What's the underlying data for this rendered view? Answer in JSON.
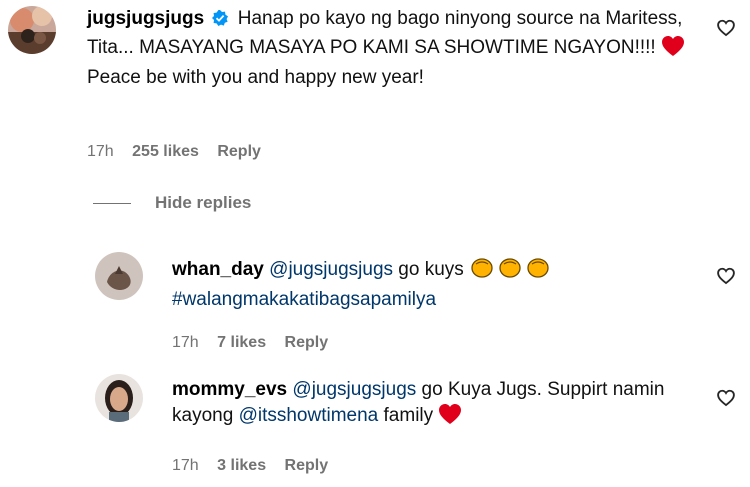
{
  "comments": [
    {
      "username": "jugsjugsjugs",
      "verified": true,
      "text": "Hanap po kayo ng bago ninyong source na Maritess, Tita... MASAYANG MASAYA PO KAMI SA SHOWTIME NGAYON!!!!",
      "text2": "Peace be with you and happy new year!",
      "time": "17h",
      "likes": "255 likes",
      "reply_label": "Reply"
    }
  ],
  "hide_replies_label": "Hide replies",
  "replies": [
    {
      "username": "whan_day",
      "mention": "@jugsjugsjugs",
      "text": "go kuys",
      "hashtag": "#walangmakakatibagsapamilya",
      "time": "17h",
      "likes": "7 likes",
      "reply_label": "Reply"
    },
    {
      "username": "mommy_evs",
      "mention": "@jugsjugsjugs",
      "text": "go Kuya Jugs. Suppirt namin kayong",
      "mention2": "@itsshowtimena",
      "text_after": "family",
      "time": "17h",
      "likes": "3 likes",
      "reply_label": "Reply"
    }
  ],
  "colors": {
    "link": "#00376b",
    "verified": "#0095f6",
    "heart": "#e0001b",
    "meta": "#737373"
  }
}
